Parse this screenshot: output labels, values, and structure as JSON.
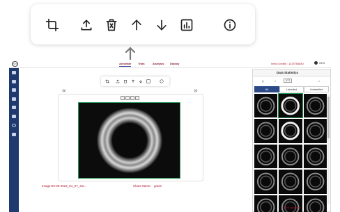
{
  "topbar": {
    "logo_text": "PHYS",
    "tabs": [
      {
        "label": "Annotate"
      },
      {
        "label": "Train"
      },
      {
        "label": "Analysis"
      },
      {
        "label": "Deploy"
      }
    ],
    "credits": "Infra Credits : 1119784840",
    "user": "OK3"
  },
  "image_info": {
    "image_name": "Image:03-08-2022_04_07_41I...",
    "class_name_label": "Class Name:",
    "class_name_value": "grass"
  },
  "panel": {
    "title": "Data Statistics",
    "pager_first": "|<",
    "pager_prev": "<",
    "page": "3/72",
    "pager_next": ">",
    "filters": [
      {
        "label": "All"
      },
      {
        "label": "Labelled"
      },
      {
        "label": "Unlabelled"
      }
    ],
    "uploaded": "100% uploaded"
  },
  "navigation": {
    "prev": "«",
    "next": "»"
  }
}
